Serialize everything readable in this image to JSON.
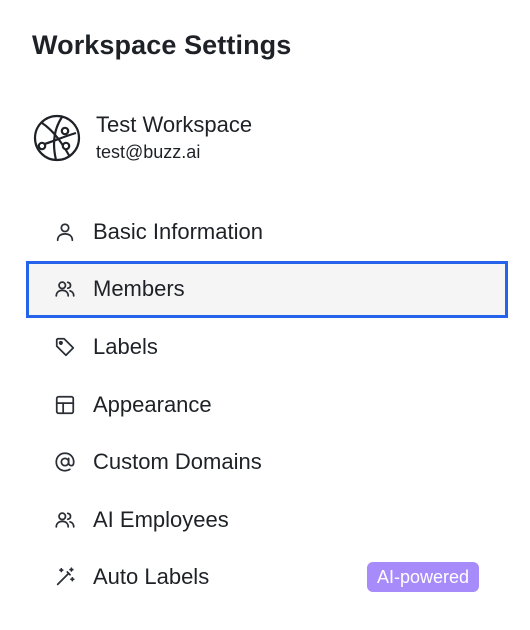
{
  "header": {
    "title": "Workspace Settings"
  },
  "workspace": {
    "name": "Test Workspace",
    "email": "test@buzz.ai",
    "logo_icon": "globe-logo-icon"
  },
  "nav": {
    "items": [
      {
        "label": "Basic Information",
        "icon": "user-icon",
        "active": false
      },
      {
        "label": "Members",
        "icon": "users-icon",
        "active": true
      },
      {
        "label": "Labels",
        "icon": "tag-icon",
        "active": false
      },
      {
        "label": "Appearance",
        "icon": "layout-icon",
        "active": false
      },
      {
        "label": "Custom Domains",
        "icon": "at-sign-icon",
        "active": false
      },
      {
        "label": "AI Employees",
        "icon": "users-icon",
        "active": false
      },
      {
        "label": "Auto Labels",
        "icon": "magic-wand-icon",
        "active": false,
        "badge": "AI-powered"
      }
    ]
  },
  "colors": {
    "active_border": "#2563eb",
    "active_background": "#f5f5f5",
    "badge_background": "#a78bfa",
    "badge_text": "#ffffff"
  }
}
